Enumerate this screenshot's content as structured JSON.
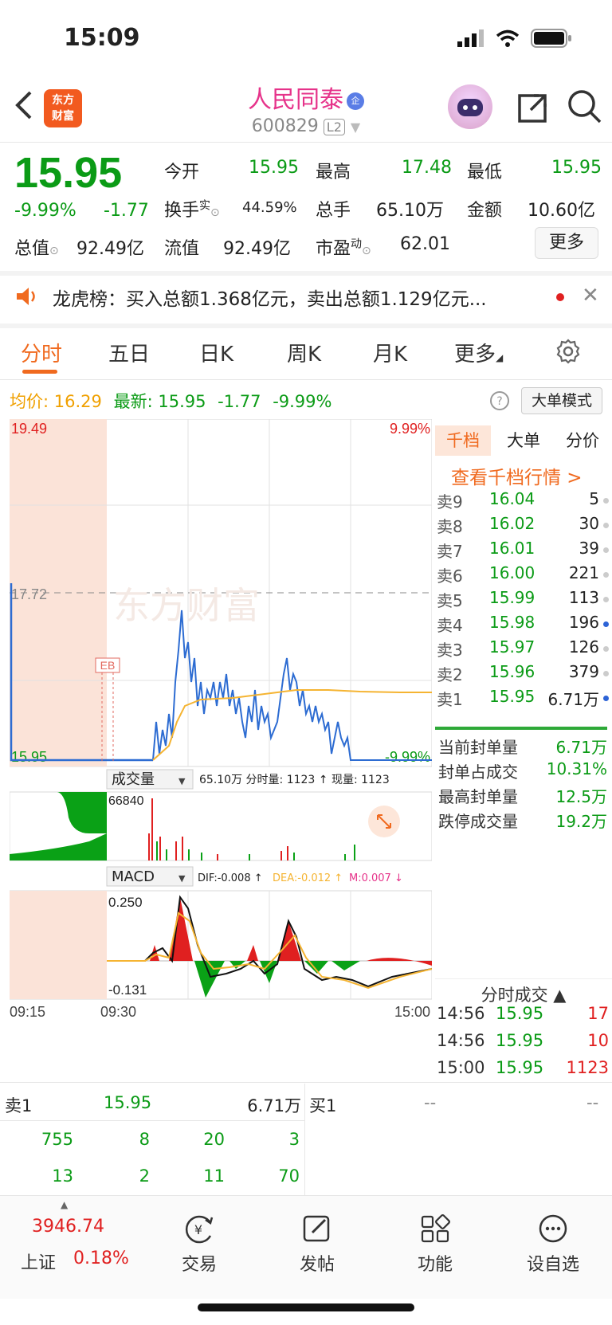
{
  "status": {
    "time": "15:09"
  },
  "header": {
    "logo_text": "东方财富",
    "title": "人民同泰",
    "title_badge": "企",
    "code": "600829",
    "level": "L2"
  },
  "quote": {
    "price": "15.95",
    "change_pct": "-9.99%",
    "change": "-1.77",
    "open_label": "今开",
    "open": "15.95",
    "high_label": "最高",
    "high": "17.48",
    "low_label": "最低",
    "low": "15.95",
    "turnover_label": "换手",
    "turnover_sup": "实",
    "turnover": "44.59%",
    "volume_label": "总手",
    "volume": "65.10万",
    "amount_label": "金额",
    "amount": "10.60亿",
    "mktcap_label": "总值",
    "mktcap": "92.49亿",
    "float_label": "流值",
    "float": "92.49亿",
    "pe_label": "市盈",
    "pe_sup": "动",
    "pe": "62.01",
    "more": "更多"
  },
  "news": {
    "text": "龙虎榜：买入总额1.368亿元，卖出总额1.129亿元..."
  },
  "tabs": [
    "分时",
    "五日",
    "日K",
    "周K",
    "月K",
    "更多"
  ],
  "infoline": {
    "avg_label": "均价:",
    "avg": "16.29",
    "last_label": "最新:",
    "last": "15.95",
    "chg": "-1.77",
    "pct": "-9.99%",
    "big_order": "大单模式"
  },
  "chart": {
    "y_top": "19.49",
    "y_mid": "17.72",
    "y_bot": "15.95",
    "pct_top": "9.99%",
    "pct_bot": "-9.99%",
    "watermark": "东方财富",
    "marker": "EB",
    "vol_selector": "成交量",
    "vol_info": "65.10万 分时量: 1123 ↑ 现量: 1123",
    "vol_max": "66840",
    "macd_selector": "MACD",
    "macd_dif": "DIF:-0.008 ↑",
    "macd_dea": "DEA:-0.012 ↑",
    "macd_m": "M:0.007 ↓",
    "macd_top": "0.250",
    "macd_bot": "-0.131",
    "time_start": "09:15",
    "time_open": "09:30",
    "time_end": "15:00"
  },
  "orderbook": {
    "tabs": [
      "千档",
      "大单",
      "分价"
    ],
    "link": "查看千档行情 >",
    "asks": [
      {
        "label": "卖9",
        "price": "16.04",
        "vol": "5",
        "dot": "gray"
      },
      {
        "label": "卖8",
        "price": "16.02",
        "vol": "30",
        "dot": "gray"
      },
      {
        "label": "卖7",
        "price": "16.01",
        "vol": "39",
        "dot": "gray"
      },
      {
        "label": "卖6",
        "price": "16.00",
        "vol": "221",
        "dot": "gray"
      },
      {
        "label": "卖5",
        "price": "15.99",
        "vol": "113",
        "dot": "gray"
      },
      {
        "label": "卖4",
        "price": "15.98",
        "vol": "196",
        "dot": "blue"
      },
      {
        "label": "卖3",
        "price": "15.97",
        "vol": "126",
        "dot": "gray"
      },
      {
        "label": "卖2",
        "price": "15.96",
        "vol": "379",
        "dot": "gray"
      },
      {
        "label": "卖1",
        "price": "15.95",
        "vol": "6.71万",
        "dot": "blue"
      }
    ],
    "seal": [
      {
        "k": "当前封单量",
        "v": "6.71万"
      },
      {
        "k": "封单占成交",
        "v": "10.31%"
      },
      {
        "k": "最高封单量",
        "v": "12.5万"
      },
      {
        "k": "跌停成交量",
        "v": "19.2万"
      }
    ],
    "ticks_header": "分时成交 ▲",
    "ticks": [
      {
        "t": "14:56",
        "p": "15.95",
        "v": "17"
      },
      {
        "t": "14:56",
        "p": "15.95",
        "v": "10"
      },
      {
        "t": "15:00",
        "p": "15.95",
        "v": "1123"
      }
    ]
  },
  "bottom_quote": {
    "sell_label": "卖1",
    "sell_price": "15.95",
    "sell_vol": "6.71万",
    "buy_label": "买1",
    "buy_price": "--",
    "buy_vol": "--",
    "row1": [
      "755",
      "8",
      "20",
      "3"
    ],
    "row2": [
      "13",
      "2",
      "11",
      "70"
    ]
  },
  "nav": {
    "index_value": "3946.74",
    "index_name": "上证",
    "index_pct": "0.18%",
    "items": [
      "交易",
      "发帖",
      "功能",
      "设自选"
    ]
  }
}
